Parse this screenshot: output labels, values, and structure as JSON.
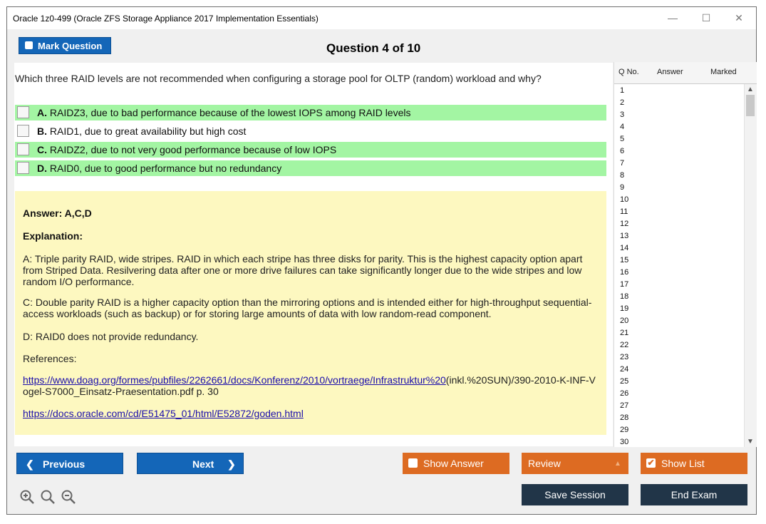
{
  "window": {
    "title": "Oracle 1z0-499 (Oracle ZFS Storage Appliance 2017 Implementation Essentials)",
    "minimize": "—",
    "maximize": "☐",
    "close": "✕"
  },
  "header": {
    "mark_question": "Mark Question",
    "question_counter": "Question 4 of 10"
  },
  "question": {
    "text": "Which three RAID levels are not recommended when configuring a storage pool for OLTP (random) workload and why?",
    "options": [
      {
        "letter": "A.",
        "text": "RAIDZ3, due to bad performance because of the lowest IOPS among RAID levels",
        "correct": true
      },
      {
        "letter": "B.",
        "text": "RAID1, due to great availability but high cost",
        "correct": false
      },
      {
        "letter": "C.",
        "text": "RAIDZ2, due to not very good performance because of low IOPS",
        "correct": true
      },
      {
        "letter": "D.",
        "text": "RAID0, due to good performance but no redundancy",
        "correct": true
      }
    ]
  },
  "answer": {
    "answer_line": "Answer: A,C,D",
    "explanation_label": "Explanation:",
    "para_a": "A: Triple parity RAID, wide stripes. RAID in which each stripe has three disks for parity. This is the highest capacity option apart from Striped Data. Resilvering data after one or more drive failures can take significantly longer due to the wide stripes and low random I/O performance.",
    "para_c": "C: Double parity RAID is a higher capacity option than the mirroring options and is intended either for high-throughput sequential-access workloads (such as backup) or for storing large amounts of data with low random-read component.",
    "para_d": "D: RAID0 does not provide redundancy.",
    "references_label": "References:",
    "ref1_link": "https://www.doag.org/formes/pubfiles/2262661/docs/Konferenz/2010/vortraege/Infrastruktur%20",
    "ref1_rest": "(inkl.%20SUN)/390-2010-K-INF-Vogel-S7000_Einsatz-Praesentation.pdf p. 30",
    "ref2_link": "https://docs.oracle.com/cd/E51475_01/html/E52872/goden.html"
  },
  "qlist": {
    "col_qno": "Q No.",
    "col_answer": "Answer",
    "col_marked": "Marked",
    "rows": [
      "1",
      "2",
      "3",
      "4",
      "5",
      "6",
      "7",
      "8",
      "9",
      "10",
      "11",
      "12",
      "13",
      "14",
      "15",
      "16",
      "17",
      "18",
      "19",
      "20",
      "21",
      "22",
      "23",
      "24",
      "25",
      "26",
      "27",
      "28",
      "29",
      "30"
    ]
  },
  "footer": {
    "previous": "Previous",
    "next": "Next",
    "show_answer": "Show Answer",
    "review": "Review",
    "show_list": "Show List",
    "save_session": "Save Session",
    "end_exam": "End Exam"
  },
  "colors": {
    "accent_blue": "#1466b8",
    "orange": "#dd6b22",
    "dark": "#213548",
    "correct_green": "#a3f5a3",
    "answer_bg": "#fdf8c0"
  }
}
